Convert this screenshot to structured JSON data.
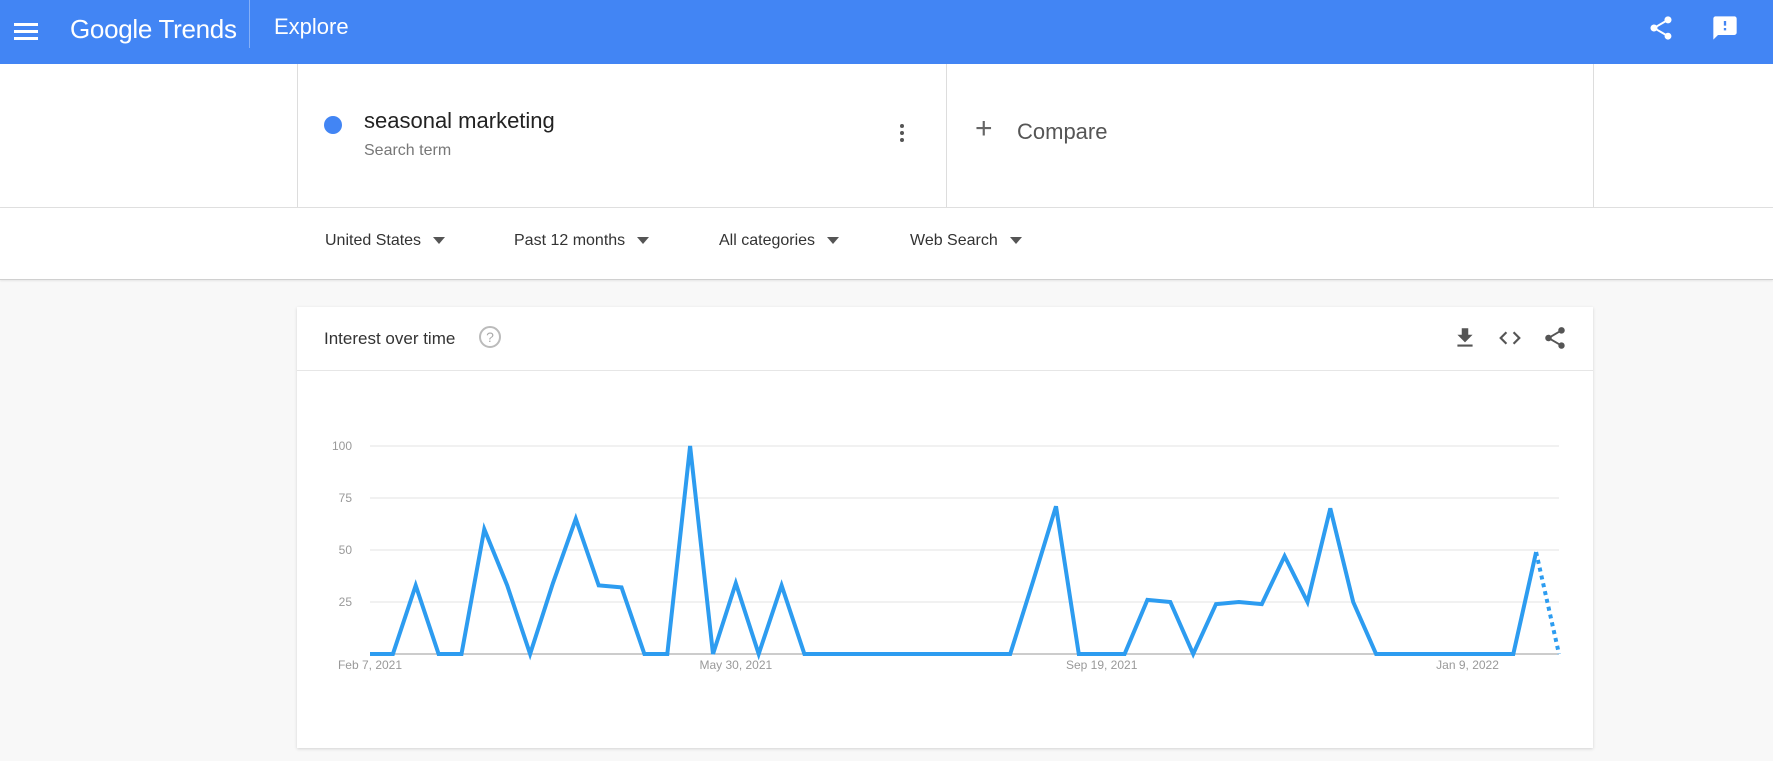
{
  "app": {
    "brand": "Google Trends",
    "page": "Explore",
    "icons": {
      "menu": "menu-icon",
      "share": "share-icon",
      "feedback": "feedback-icon"
    }
  },
  "search_term": {
    "name": "seasonal marketing",
    "type": "Search term",
    "color": "#4285f4"
  },
  "compare": {
    "label": "Compare"
  },
  "filters": {
    "region": "United States",
    "time": "Past 12 months",
    "category": "All categories",
    "property": "Web Search"
  },
  "card": {
    "title": "Interest over time",
    "icons": {
      "help": "help-icon",
      "download": "download-icon",
      "embed": "embed-icon",
      "share": "share-icon"
    }
  },
  "chart_data": {
    "type": "line",
    "title": "Interest over time",
    "ylim": [
      0,
      100
    ],
    "yticks": [
      25,
      50,
      75,
      100
    ],
    "xtick_labels": [
      "Feb 7, 2021",
      "May 30, 2021",
      "Sep 19, 2021",
      "Jan 9, 2022"
    ],
    "xtick_index": [
      0,
      16,
      32,
      48
    ],
    "grid": true,
    "series": [
      {
        "color": "#2d9cf0",
        "values": [
          0,
          0,
          33,
          0,
          0,
          60,
          33,
          0,
          34,
          65,
          33,
          32,
          0,
          0,
          100,
          0,
          34,
          0,
          33,
          0,
          0,
          0,
          0,
          0,
          0,
          0,
          0,
          0,
          0,
          35,
          71,
          0,
          0,
          0,
          26,
          25,
          0,
          24,
          25,
          24,
          47,
          25,
          70,
          25,
          0,
          0,
          0,
          0,
          0,
          0,
          0,
          49,
          0
        ],
        "partial_from_index": 51
      }
    ]
  }
}
